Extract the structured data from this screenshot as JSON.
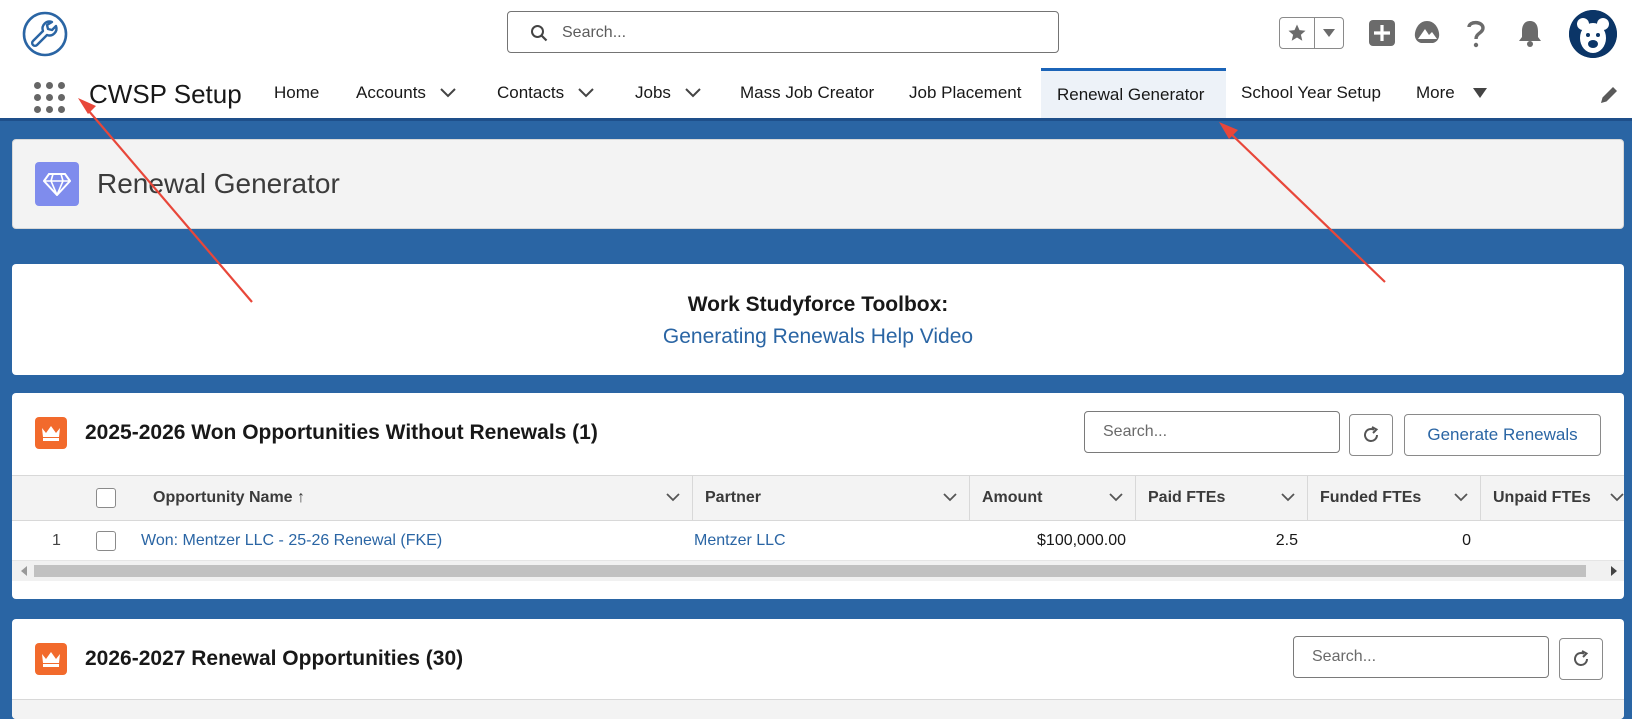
{
  "header": {
    "search_placeholder": "Search...",
    "icons": [
      "favorites-star-icon",
      "favorites-dropdown-icon",
      "global-actions-plus-icon",
      "trailhead-icon",
      "help-icon",
      "notifications-bell-icon",
      "user-avatar"
    ]
  },
  "nav": {
    "app_name": "CWSP Setup",
    "items": [
      {
        "label": "Home"
      },
      {
        "label": "Accounts"
      },
      {
        "label": "Contacts"
      },
      {
        "label": "Jobs"
      },
      {
        "label": "Mass Job Creator"
      },
      {
        "label": "Job Placement"
      },
      {
        "label": "Renewal Generator"
      },
      {
        "label": "School Year Setup"
      },
      {
        "label": "More"
      }
    ],
    "active_item": "Renewal Generator"
  },
  "page_header": {
    "title": "Renewal Generator"
  },
  "toolbox": {
    "title": "Work Studyforce Toolbox:",
    "link": "Generating Renewals Help Video"
  },
  "won_list": {
    "title": "2025-2026 Won Opportunities Without Renewals (1)",
    "search_placeholder": "Search...",
    "generate_button": "Generate Renewals",
    "columns": [
      "Opportunity Name ↑",
      "Partner",
      "Amount",
      "Paid FTEs",
      "Funded FTEs",
      "Unpaid FTEs"
    ],
    "rows": [
      {
        "num": "1",
        "opportunity": "Won: Mentzer LLC - 25-26 Renewal (FKE)",
        "partner": "Mentzer LLC",
        "amount": "$100,000.00",
        "paid": "2.5",
        "funded": "0",
        "unpaid": ""
      }
    ]
  },
  "renewal_list": {
    "title": "2026-2027 Renewal Opportunities (30)",
    "search_placeholder": "Search..."
  },
  "colors": {
    "brand_blue": "#2a65a4",
    "accent_orange": "#f26a2c",
    "header_icon_purple": "#7f8ced",
    "annotation_red": "#e8473a"
  }
}
